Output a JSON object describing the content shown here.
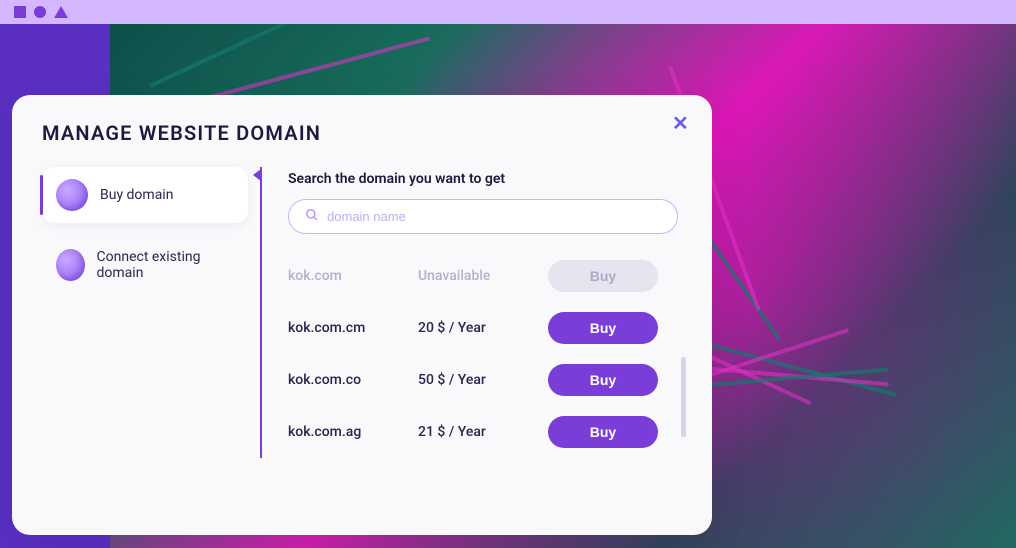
{
  "modal": {
    "title": "MANAGE WEBSITE DOMAIN"
  },
  "sidebar": {
    "items": [
      {
        "label": "Buy domain"
      },
      {
        "label": "Connect existing domain"
      }
    ]
  },
  "search": {
    "heading": "Search the domain you want to get",
    "placeholder": "domain name"
  },
  "results": [
    {
      "domain": "kok.com",
      "price": "Unavailable",
      "buy": "Buy",
      "available": false
    },
    {
      "domain": "kok.com.cm",
      "price": "20 $ / Year",
      "buy": "Buy",
      "available": true
    },
    {
      "domain": "kok.com.co",
      "price": "50 $ / Year",
      "buy": "Buy",
      "available": true
    },
    {
      "domain": "kok.com.ag",
      "price": "21 $ / Year",
      "buy": "Buy",
      "available": true
    }
  ]
}
